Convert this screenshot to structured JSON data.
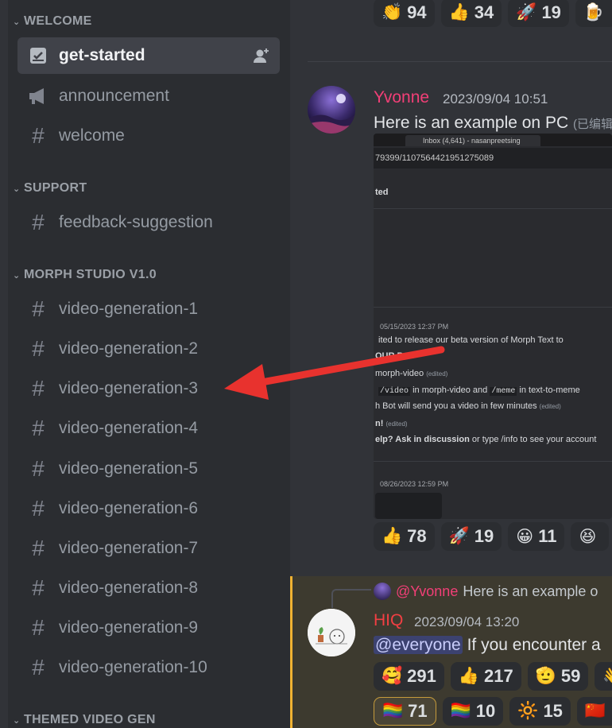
{
  "sidebar": {
    "categories": [
      {
        "label": "WELCOME"
      },
      {
        "label": "SUPPORT"
      },
      {
        "label": "MORPH STUDIO V1.0"
      },
      {
        "label": "THEMED VIDEO GEN"
      }
    ],
    "channels": [
      {
        "name": "get-started",
        "icon": "rules-icon",
        "active": true
      },
      {
        "name": "announcement",
        "icon": "megaphone-icon"
      },
      {
        "name": "welcome",
        "icon": "hash-icon"
      },
      {
        "name": "feedback-suggestion",
        "icon": "hash-icon"
      },
      {
        "name": "video-generation-1",
        "icon": "hash-icon"
      },
      {
        "name": "video-generation-2",
        "icon": "hash-icon"
      },
      {
        "name": "video-generation-3",
        "icon": "hash-icon"
      },
      {
        "name": "video-generation-4",
        "icon": "hash-icon"
      },
      {
        "name": "video-generation-5",
        "icon": "hash-icon"
      },
      {
        "name": "video-generation-6",
        "icon": "hash-icon"
      },
      {
        "name": "video-generation-7",
        "icon": "hash-icon"
      },
      {
        "name": "video-generation-8",
        "icon": "hash-icon"
      },
      {
        "name": "video-generation-9",
        "icon": "hash-icon"
      },
      {
        "name": "video-generation-10",
        "icon": "hash-icon"
      }
    ]
  },
  "top_reactions": [
    {
      "emoji": "👏",
      "count": "94"
    },
    {
      "emoji": "👍",
      "count": "34"
    },
    {
      "emoji": "🚀",
      "count": "19"
    },
    {
      "emoji": "🍺",
      "count": ""
    }
  ],
  "message1": {
    "author": "Yvonne",
    "author_color": "#f23f77",
    "timestamp": "2023/09/04 10:51",
    "text": "Here is an example on PC",
    "edited": "(已编辑",
    "screenshot": {
      "tab": "Inbox (4,641) - nasanpreetsing",
      "url": "79399/1107564421951275089",
      "heading": "ted",
      "date1": "05/15/2023 12:37 PM",
      "line1": "ited to release our beta version of Morph Text to",
      "line2": "OUR BOT",
      "line3": "morph-video",
      "edited_tag": "(edited)",
      "line4a": "/video",
      "line4b": "in morph-video and",
      "line4c": "/meme",
      "line4d": "in text-to-meme",
      "line5": "h Bot will send you a video in few minutes",
      "line6": "n!",
      "line7a": "elp? Ask in",
      "line7b": "discussion",
      "line7c": "or type /info to see your account",
      "date2": "08/26/2023 12:59 PM"
    },
    "reactions": [
      {
        "emoji": "👍",
        "count": "78"
      },
      {
        "emoji": "🚀",
        "count": "19"
      },
      {
        "emoji": "😀",
        "count": "11"
      },
      {
        "emoji": "😆",
        "count": ""
      }
    ]
  },
  "message2": {
    "reply_author": "@Yvonne",
    "reply_text": "Here is an example o",
    "author": "HIQ",
    "author_color": "#f23f43",
    "timestamp": "2023/09/04 13:20",
    "mention": "@everyone",
    "text": "If you encounter a",
    "reactions_row1": [
      {
        "emoji": "🥰",
        "count": "291"
      },
      {
        "emoji": "👍",
        "count": "217"
      },
      {
        "emoji": "🫡",
        "count": "59"
      },
      {
        "emoji": "👋",
        "count": ""
      }
    ],
    "reactions_row2": [
      {
        "emoji": "🏳️‍🌈",
        "count": "71"
      },
      {
        "emoji": "🏳️‍🌈",
        "count": "10"
      },
      {
        "emoji": "🔆",
        "count": "15"
      },
      {
        "emoji": "🇨🇳",
        "count": ""
      }
    ]
  },
  "colors": {
    "arrow": "#e8322e",
    "accent": "#f0b232"
  }
}
